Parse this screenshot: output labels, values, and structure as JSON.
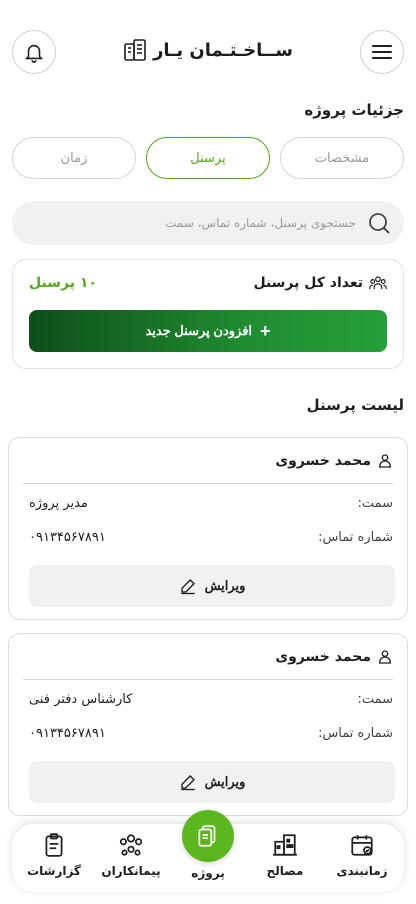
{
  "header": {
    "logo_text": "ســاخـتـمان یـار",
    "menu_icon": "hamburger-icon",
    "notification_icon": "bell-icon",
    "logo_icon": "building-icon"
  },
  "project_details": {
    "title": "جزئیات پروژه"
  },
  "tabs": [
    {
      "label": "مشخصات",
      "active": false
    },
    {
      "label": "پرسنل",
      "active": true
    },
    {
      "label": "زمان",
      "active": false
    }
  ],
  "search": {
    "placeholder": "جستجوی پرسنل، شماره تماس، سمت",
    "value": ""
  },
  "summary": {
    "title": "تعداد کل پرسنل",
    "count": "۱۰ پرسنل",
    "add_label": "افزودن پرسنل جدید"
  },
  "personnel_list": {
    "title": "لیست پرسنل",
    "position_label": "سمت:",
    "phone_label": "شماره تماس:",
    "edit_label": "ویرایش",
    "items": [
      {
        "name": "محمد خسروی",
        "position": "مدیر پروژه",
        "phone": "۰۹۱۳۴۵۶۷۸۹۱"
      },
      {
        "name": "محمد خسروی",
        "position": "کارشناس دفتر فنی",
        "phone": "۰۹۱۳۴۵۶۷۸۹۱"
      }
    ]
  },
  "bottom_nav": [
    {
      "label": "زمانبندی",
      "icon": "calendar-check-icon"
    },
    {
      "label": "مصالح",
      "icon": "materials-icon"
    },
    {
      "label": "پروژه",
      "icon": "project-documents-icon",
      "active": true
    },
    {
      "label": "پیمانکاران",
      "icon": "contractors-icon"
    },
    {
      "label": "گزارشات",
      "icon": "clipboard-icon"
    }
  ],
  "colors": {
    "accent": "#56a81f",
    "button_dark": "#0e4f1a",
    "nav_active": "#5cb71f"
  }
}
